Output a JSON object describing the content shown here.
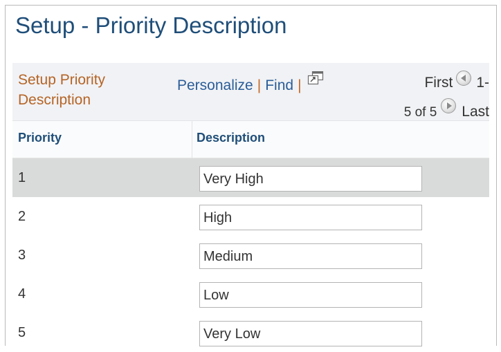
{
  "page": {
    "title": "Setup - Priority Description"
  },
  "grid": {
    "title": "Setup Priority Description",
    "toolbar": {
      "personalize_label": "Personalize",
      "separator": "|",
      "find_label": "Find",
      "new_window_icon": "new-window-icon"
    },
    "navigation": {
      "first_label": "First",
      "range_start": "1-",
      "range_rest": "5 of 5",
      "last_label": "Last",
      "prev_icon": "previous-arrow-icon",
      "next_icon": "next-arrow-icon"
    },
    "columns": [
      "Priority",
      "Description"
    ],
    "rows": [
      {
        "priority": "1",
        "description": "Very High"
      },
      {
        "priority": "2",
        "description": "High"
      },
      {
        "priority": "3",
        "description": "Medium"
      },
      {
        "priority": "4",
        "description": "Low"
      },
      {
        "priority": "5",
        "description": "Very Low"
      }
    ]
  },
  "colors": {
    "title": "#1f4e79",
    "grid_title": "#b56425",
    "link": "#2a5d98",
    "header_bg": "#f1f2f5",
    "selected_row_bg": "#d9dbda"
  }
}
